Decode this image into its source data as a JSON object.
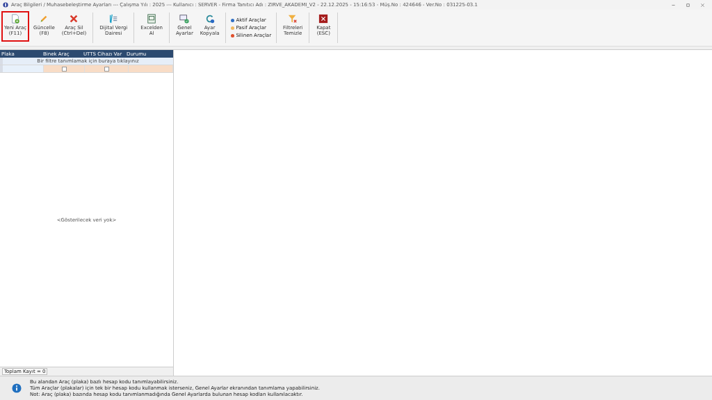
{
  "window": {
    "title": "Araç Bilgileri / Muhasebeleştirme Ayarları  ---  Çalışma Yılı : 2025  ---  Kullanıcı : SERVER - Firma Tanıtıcı Adı : ZIRVE_AKADEMI_V2 - 22.12.2025 - 15:16:53 - Müş.No : 424646 - Ver.No : 031225-03.1"
  },
  "toolbar": [
    {
      "kind": "button",
      "lines": [
        "Yeni Araç",
        "(F11)"
      ],
      "highlighted": true
    },
    {
      "kind": "button",
      "lines": [
        "Güncelle",
        "(F8)"
      ],
      "highlighted": false
    },
    {
      "kind": "button",
      "lines": [
        "Araç Sil",
        "(Ctrl+Del)"
      ],
      "highlighted": false
    },
    {
      "kind": "separator"
    },
    {
      "kind": "button",
      "lines": [
        "Dijital Vergi",
        "Dairesi"
      ],
      "highlighted": false
    },
    {
      "kind": "separator"
    },
    {
      "kind": "button",
      "lines": [
        "Excelden",
        "Al"
      ],
      "highlighted": false
    },
    {
      "kind": "separator"
    },
    {
      "kind": "button",
      "lines": [
        "Genel",
        "Ayarlar"
      ],
      "highlighted": false
    },
    {
      "kind": "button",
      "lines": [
        "Ayar",
        "Kopyala"
      ],
      "highlighted": false
    },
    {
      "kind": "separator"
    },
    {
      "kind": "legend",
      "items": [
        {
          "label": "Aktif Araçlar",
          "color": "#2f6fc4"
        },
        {
          "label": "Pasif Araçlar",
          "color": "#f0b860"
        },
        {
          "label": "Silinen Araçlar",
          "color": "#e0502c"
        }
      ]
    },
    {
      "kind": "separator"
    },
    {
      "kind": "button",
      "lines": [
        "Filtreleri",
        "Temizle"
      ],
      "highlighted": false
    },
    {
      "kind": "separator"
    },
    {
      "kind": "button",
      "lines": [
        "Kapat",
        "(ESC)"
      ],
      "highlighted": false
    },
    {
      "kind": "separator"
    }
  ],
  "grid": {
    "columns": [
      "Plaka",
      "Binek Araç",
      "UTTS Cihazı Var",
      "Durumu"
    ],
    "filter_hint": "Bir filtre tanımlamak için buraya tıklayınız",
    "new_row": {
      "binek": false,
      "utts": false
    },
    "empty_text": "<Gösterilecek veri yok>",
    "total": "Toplam Kayıt = 0"
  },
  "info": [
    "Bu alandan Araç (plaka) bazlı hesap kodu tanımlayabilirsiniz.",
    "Tüm Araçlar (plakalar) için tek bir hesap kodu kullanmak isterseniz, Genel Ayarlar ekranından tanımlama yapabilirsiniz.",
    "Not: Araç (plaka) bazında hesap kodu tanımlanmadığında Genel Ayarlarda bulunan hesap kodları kullanılacaktır."
  ]
}
